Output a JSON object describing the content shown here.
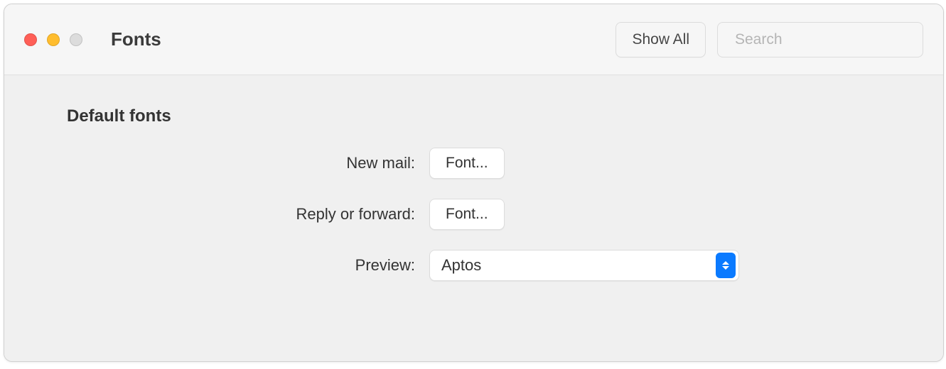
{
  "window": {
    "title": "Fonts"
  },
  "toolbar": {
    "show_all_label": "Show All",
    "search_placeholder": "Search"
  },
  "section": {
    "heading": "Default fonts"
  },
  "rows": {
    "new_mail": {
      "label": "New mail:",
      "button": "Font..."
    },
    "reply_forward": {
      "label": "Reply or forward:",
      "button": "Font..."
    },
    "preview": {
      "label": "Preview:",
      "value": "Aptos"
    }
  }
}
